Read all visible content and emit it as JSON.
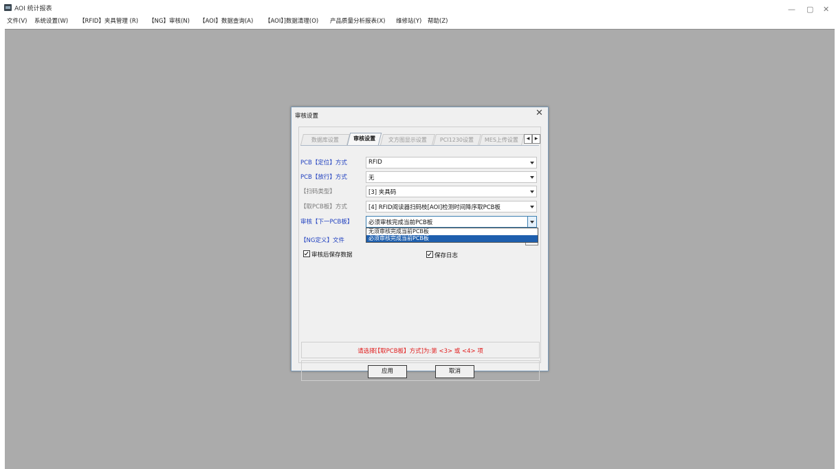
{
  "window": {
    "title": "AOI 统计报表",
    "controls": {
      "minimize": "—",
      "restore": "▢",
      "close": "✕"
    }
  },
  "menubar": [
    "文件(V)",
    "系统设置(W)",
    "【RFID】夹具管理 (R)",
    "【NG】审核(N)",
    "【AOI】数据查询(A)",
    "【AOI】]数据清理(O)",
    "产品质量分析报表(X)",
    "维修站(Y)",
    "帮助(Z)"
  ],
  "dialog": {
    "title": "审核设置",
    "close": "✕",
    "tabs": [
      "数据库设置",
      "审核设置",
      "文方图显示设置",
      "PCI1230设置",
      "MES上传设置"
    ],
    "active_tab": 1,
    "tab_scroll": [
      "◀",
      "▶"
    ],
    "fields": [
      {
        "label": "PCB【定位】方式",
        "value": "RFID",
        "label_color": "blue"
      },
      {
        "label": "PCB【放行】方式",
        "value": "无",
        "label_color": "blue"
      },
      {
        "label": "【扫码类型】",
        "value": "[3] 夹具码",
        "label_color": "gray"
      },
      {
        "label": "【取PCB板】方式",
        "value": "[4] RFID阅读器扫码枝[AOI]检测时间降序取PCB板",
        "label_color": "gray"
      },
      {
        "label": "审核【下一PCB板】",
        "value": "必须审核完成当前PCB板",
        "label_color": "blue"
      }
    ],
    "dropdown_options": [
      "无须审核完成当前PCB板",
      "必须审核完成当前PCB板"
    ],
    "dropdown_selected": 1,
    "ng_label": "【NG定义】文件",
    "checkboxes": [
      {
        "label": "审核后保存数据",
        "checked": true
      },
      {
        "label": "保存日志",
        "checked": true
      }
    ],
    "hint": "请选择[【取PCB板】方式]为:第 <3> 或 <4> 项",
    "buttons": {
      "apply": "应用",
      "cancel": "取消"
    }
  }
}
